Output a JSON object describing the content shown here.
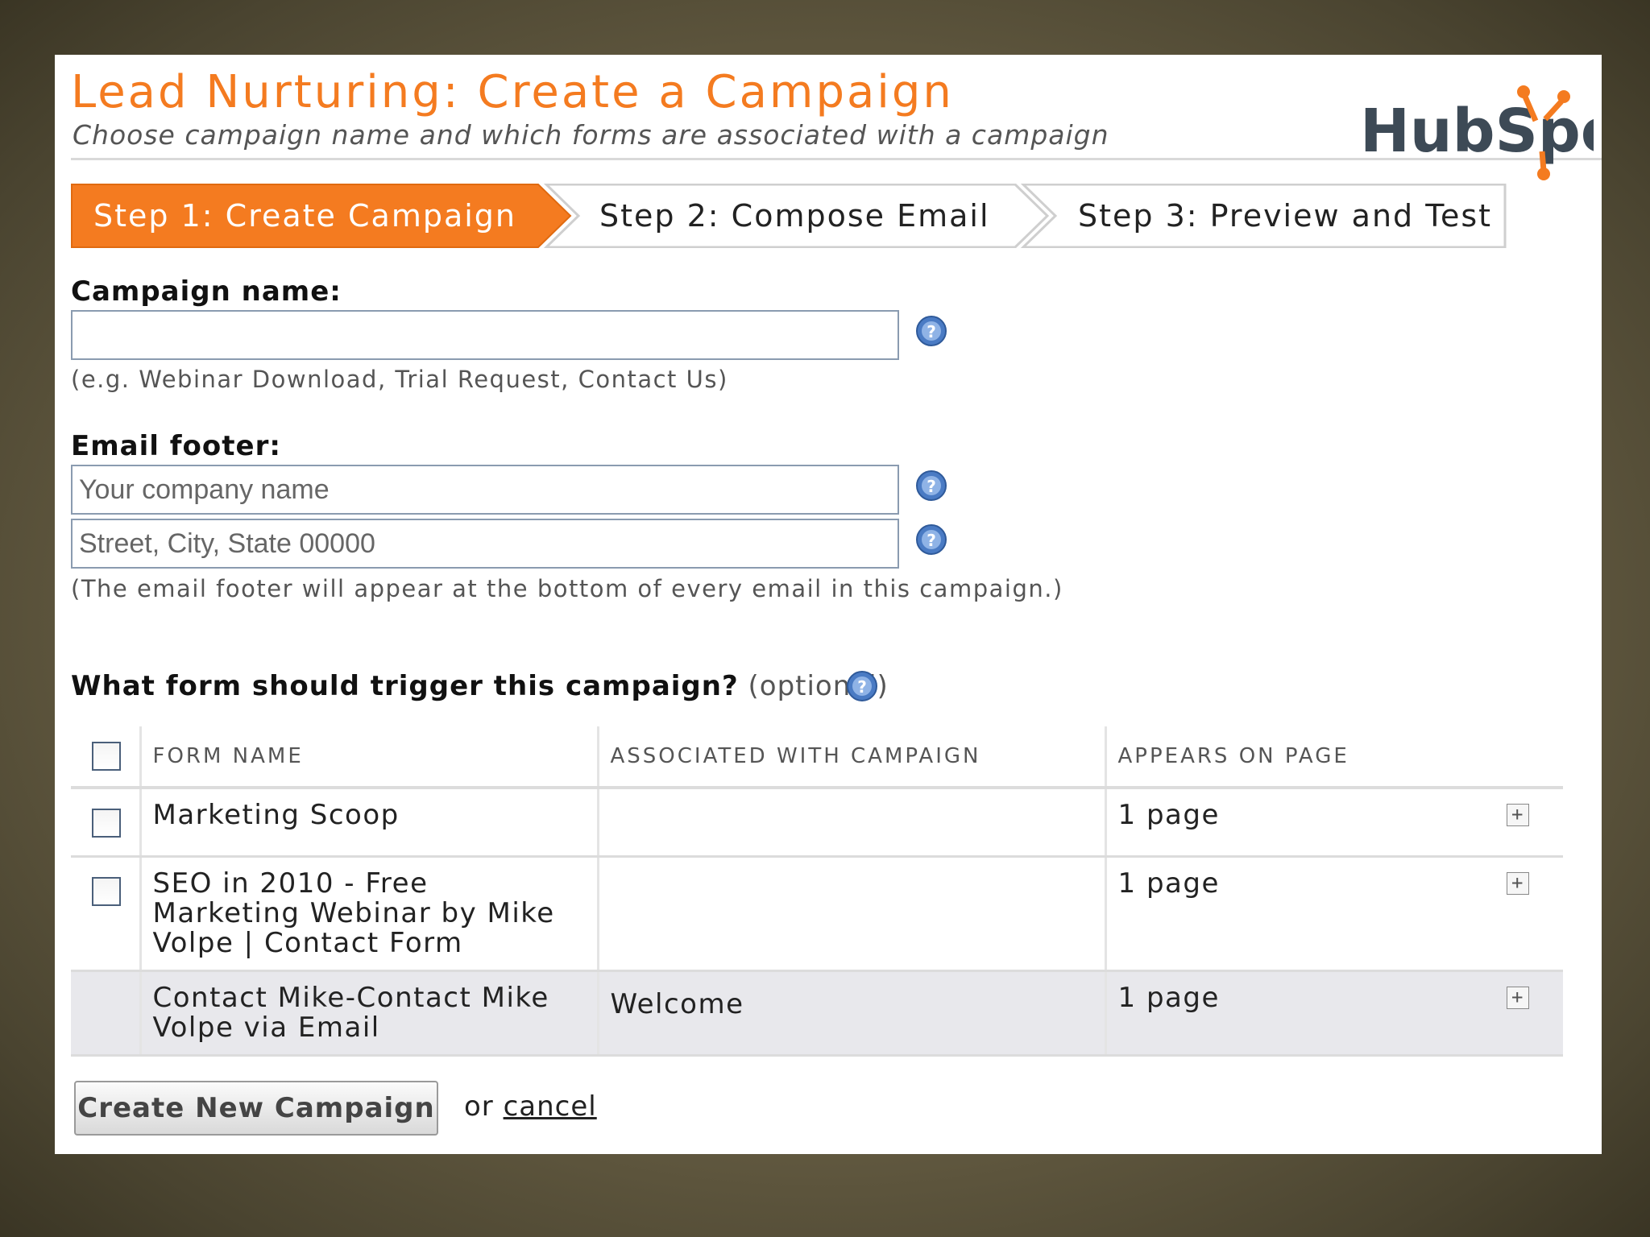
{
  "header": {
    "title": "Lead Nurturing: Create a Campaign",
    "subtitle": "Choose campaign name and which forms are associated with a campaign",
    "logo_text": "HubSpot",
    "accent_color": "#f47b20"
  },
  "steps": [
    {
      "label": "Step 1: Create Campaign",
      "active": true
    },
    {
      "label": "Step 2: Compose Email",
      "active": false
    },
    {
      "label": "Step 3: Preview and Test",
      "active": false
    }
  ],
  "campaign": {
    "label": "Campaign name:",
    "value": "",
    "hint": "(e.g. Webinar Download, Trial Request, Contact Us)"
  },
  "footer": {
    "label": "Email footer:",
    "company_placeholder": "Your company name",
    "address_placeholder": "Street, City, State 00000",
    "hint": "(The email footer will appear at the bottom of every email in this campaign.)"
  },
  "trigger": {
    "question": "What form should trigger this campaign?",
    "optional": "(optional)"
  },
  "table": {
    "columns": [
      "FORM NAME",
      "ASSOCIATED WITH CAMPAIGN",
      "APPEARS ON PAGE"
    ],
    "rows": [
      {
        "form_name": "Marketing Scoop",
        "campaign": "",
        "appears": "1 page"
      },
      {
        "form_name": "SEO in 2010 - Free Marketing Webinar by Mike Volpe | Contact Form",
        "campaign": "",
        "appears": "1 page"
      },
      {
        "form_name": "Contact Mike-Contact Mike Volpe via Email",
        "campaign": "Welcome",
        "appears": "1 page"
      }
    ]
  },
  "actions": {
    "submit_label": "Create New Campaign",
    "or_text": "or",
    "cancel_label": "cancel"
  },
  "icons": {
    "help": "help-icon",
    "expand": "+"
  }
}
